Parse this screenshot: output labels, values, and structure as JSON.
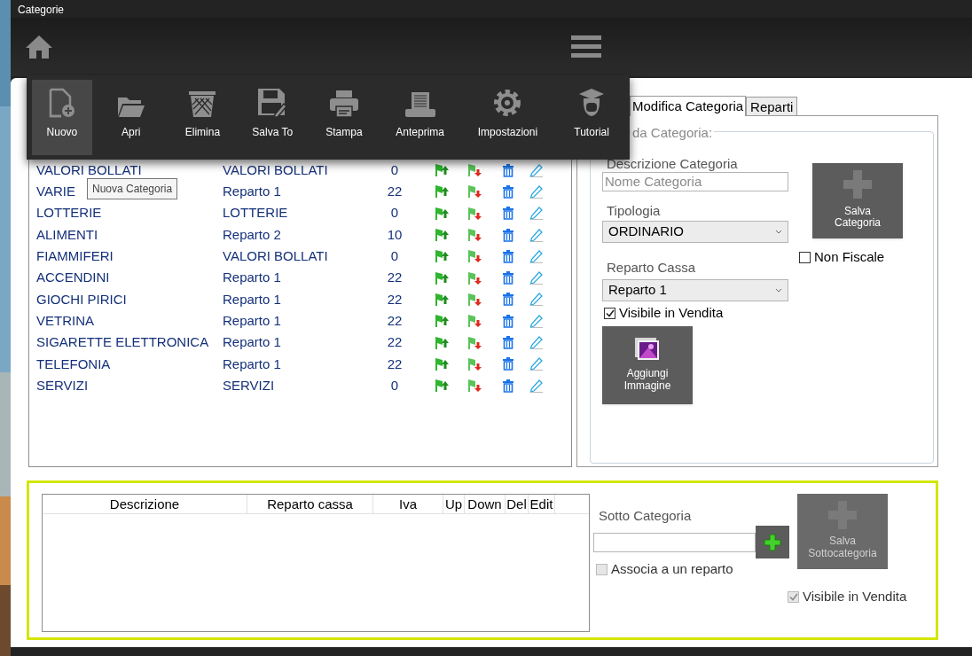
{
  "window": {
    "title": "Categorie"
  },
  "toolbar": {
    "items": [
      {
        "label": "Nuovo",
        "kind": "new",
        "selected": true
      },
      {
        "label": "Apri",
        "kind": "open",
        "selected": false
      },
      {
        "label": "Elimina",
        "kind": "trash",
        "selected": false
      },
      {
        "label": "Salva To",
        "kind": "save",
        "selected": false
      },
      {
        "label": "Stampa",
        "kind": "print",
        "selected": false
      },
      {
        "label": "Anteprima",
        "kind": "preview",
        "selected": false
      },
      {
        "label": "Impostazioni",
        "kind": "settings",
        "selected": false
      },
      {
        "label": "Tutorial",
        "kind": "tutorial",
        "selected": false
      }
    ]
  },
  "tooltip": "Nuova Categoria",
  "categories": {
    "rows": [
      {
        "descrizione": "VALORI BOLLATI",
        "reparto": "VALORI BOLLATI",
        "iva": "0"
      },
      {
        "descrizione": "VARIE",
        "reparto": "Reparto 1",
        "iva": "22"
      },
      {
        "descrizione": "LOTTERIE",
        "reparto": "LOTTERIE",
        "iva": "0"
      },
      {
        "descrizione": "ALIMENTI",
        "reparto": "Reparto 2",
        "iva": "10"
      },
      {
        "descrizione": "FIAMMIFERI",
        "reparto": "VALORI BOLLATI",
        "iva": "0"
      },
      {
        "descrizione": "ACCENDINI",
        "reparto": "Reparto 1",
        "iva": "22"
      },
      {
        "descrizione": "GIOCHI PIRICI",
        "reparto": "Reparto 1",
        "iva": "22"
      },
      {
        "descrizione": "VETRINA",
        "reparto": "Reparto 1",
        "iva": "22"
      },
      {
        "descrizione": "SIGARETTE ELETTRONICA",
        "reparto": "Reparto 1",
        "iva": "22"
      },
      {
        "descrizione": "TELEFONIA",
        "reparto": "Reparto 1",
        "iva": "22"
      },
      {
        "descrizione": "SERVIZI",
        "reparto": "SERVIZI",
        "iva": "0"
      }
    ]
  },
  "tabs": [
    {
      "label": "Modifica Categoria",
      "selected": true
    },
    {
      "label": "Reparti",
      "selected": false
    }
  ],
  "scheda": {
    "legend": "da Categoria:",
    "descrizione": {
      "label": "Descrizione Categoria",
      "placeholder": "Nome Categoria"
    },
    "tipologia": {
      "label": "Tipologia",
      "value": "ORDINARIO"
    },
    "reparto_cassa": {
      "label": "Reparto Cassa",
      "value": "Reparto 1"
    },
    "visibile": {
      "label": "Visibile in Vendita",
      "checked": true,
      "disabled": false
    },
    "aggiungi_immagine": "Aggiungi Immagine",
    "salva": "Salva Categoria",
    "non_fiscale": {
      "label": "Non Fiscale",
      "checked": false,
      "disabled": false
    }
  },
  "subcategories": {
    "columns": [
      "Descrizione",
      "Reparto cassa",
      "Iva",
      "Up",
      "Down",
      "Del",
      "Edit"
    ],
    "label": "Sotto Categoria",
    "associa": {
      "label": "Associa a un reparto",
      "checked": false,
      "disabled": true
    },
    "salva": "Salva Sottocategoria",
    "visibile": {
      "label": "Visibile in Vendita",
      "checked": true,
      "disabled": true
    }
  }
}
